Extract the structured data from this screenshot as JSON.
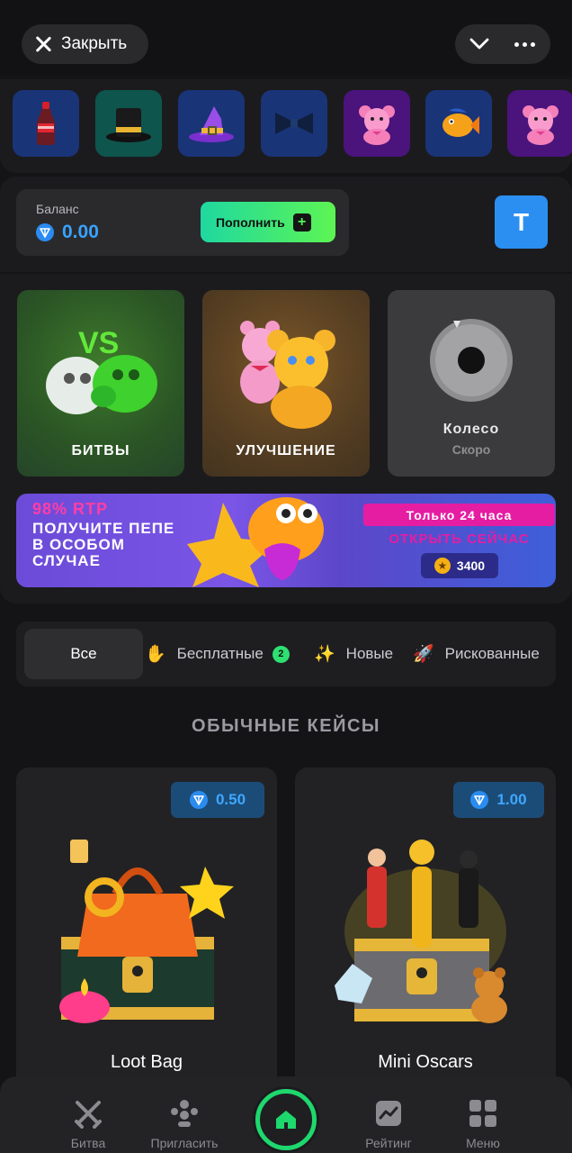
{
  "topbar": {
    "close_label": "Закрыть"
  },
  "gifts": [
    {
      "icon": "soda-bottle-icon",
      "glyph": "🥤",
      "bg": "#1c3c86"
    },
    {
      "icon": "top-hat-icon",
      "glyph": "🎩",
      "bg": "#0f5a52"
    },
    {
      "icon": "witch-hat-icon",
      "glyph": "🧙",
      "bg": "#1c3c86"
    },
    {
      "icon": "bow-tie-icon",
      "glyph": "🎀",
      "bg": "#1c3c86"
    },
    {
      "icon": "pink-bear-icon",
      "glyph": "🧸",
      "bg": "#4a1a6e"
    },
    {
      "icon": "fish-icon",
      "glyph": "🐠",
      "bg": "#1c3c86"
    },
    {
      "icon": "pink-bear-icon",
      "glyph": "🧸",
      "bg": "#4a1a6e"
    }
  ],
  "balance": {
    "label": "Баланс",
    "value": "0.00",
    "topup_label": "Пополнить",
    "avatar_letter": "T"
  },
  "modes": [
    {
      "title": "БИТВЫ",
      "subtitle": ""
    },
    {
      "title": "УЛУЧШЕНИЕ",
      "subtitle": ""
    },
    {
      "title": "Колесо",
      "subtitle": "Скоро"
    }
  ],
  "promo": {
    "rtp": "98% RTP",
    "text": "ПОЛУЧИТЕ ПЕПЕ В ОСОБОМ СЛУЧАЕ",
    "time_label": "Только 24 часа",
    "open_label": "ОТКРЫТЬ СЕЙЧАС",
    "price": "3400"
  },
  "filters": {
    "all": "Все",
    "free": "Бесплатные",
    "free_count": "2",
    "new": "Новые",
    "risky": "Рискованные"
  },
  "section_title": "ОБЫЧНЫЕ КЕЙСЫ",
  "cases": [
    {
      "name": "Loot Bag",
      "price": "0.50"
    },
    {
      "name": "Mini Oscars",
      "price": "1.00"
    }
  ],
  "nav": {
    "battle": "Битва",
    "invite": "Пригласить",
    "rating": "Рейтинг",
    "menu": "Меню"
  },
  "colors": {
    "accent_green": "#1ed86d",
    "ton_blue": "#2a8cf0",
    "promo_pink": "#e51da2"
  }
}
